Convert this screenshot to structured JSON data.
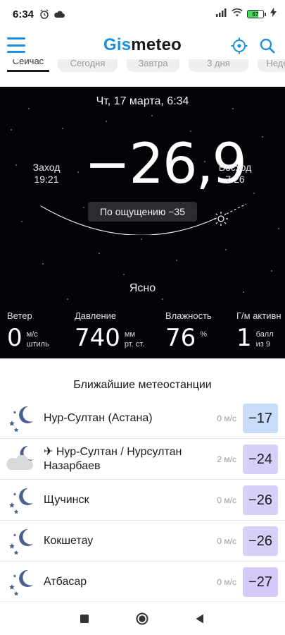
{
  "status_bar": {
    "time": "6:34",
    "battery": "67",
    "battery_level": 0.67,
    "icons": [
      "alarm-icon",
      "cloud-icon",
      "signal-icon",
      "wifi-icon",
      "battery-icon",
      "charging-icon"
    ]
  },
  "header": {
    "logo_part1": "Gis",
    "logo_part2": "meteo",
    "brand_color": "#1e8fe0"
  },
  "tabs": [
    {
      "label": "Сейчас",
      "active": true
    },
    {
      "label": "Сегодня",
      "active": false
    },
    {
      "label": "Завтра",
      "active": false
    },
    {
      "label": "3 дня",
      "active": false
    },
    {
      "label": "Неделя",
      "active": false
    }
  ],
  "weather": {
    "date": "Чт, 17 марта, 6:34",
    "sunset_label": "Заход",
    "sunset_time": "19:21",
    "sunrise_label": "Восход",
    "sunrise_time": "7:26",
    "temperature": "−26,9",
    "feels_like": "По ощущению −35",
    "condition": "Ясно"
  },
  "metrics": {
    "wind": {
      "title": "Ветер",
      "value": "0",
      "unit1": "м/с",
      "unit2": "штиль"
    },
    "pressure": {
      "title": "Давление",
      "value": "740",
      "unit1": "мм",
      "unit2": "рт. ст."
    },
    "humidity": {
      "title": "Влажность",
      "value": "76",
      "unit1": "%",
      "unit2": ""
    },
    "geomagnetic": {
      "title": "Г/м активн",
      "value": "1",
      "unit1": "балл",
      "unit2": "из 9"
    }
  },
  "stations": {
    "title": "Ближайшие метеостанции",
    "items": [
      {
        "name": "Нур-Султан (Астана)",
        "wind": "0 м/с",
        "temp": "−17",
        "color": "#c8dcfa",
        "icon": "moon-stars-icon"
      },
      {
        "name": "✈ Нур-Султан / Нурсултан Назарбаев",
        "wind": "2 м/с",
        "temp": "−24",
        "color": "#d8cff8",
        "icon": "moon-cloud-icon"
      },
      {
        "name": "Щучинск",
        "wind": "0 м/с",
        "temp": "−26",
        "color": "#d8cff8",
        "icon": "moon-stars-icon"
      },
      {
        "name": "Кокшетау",
        "wind": "0 м/с",
        "temp": "−26",
        "color": "#d8cff8",
        "icon": "moon-stars-icon"
      },
      {
        "name": "Атбасар",
        "wind": "0 м/с",
        "temp": "−27",
        "color": "#d4c9f7",
        "icon": "moon-stars-icon"
      }
    ]
  }
}
